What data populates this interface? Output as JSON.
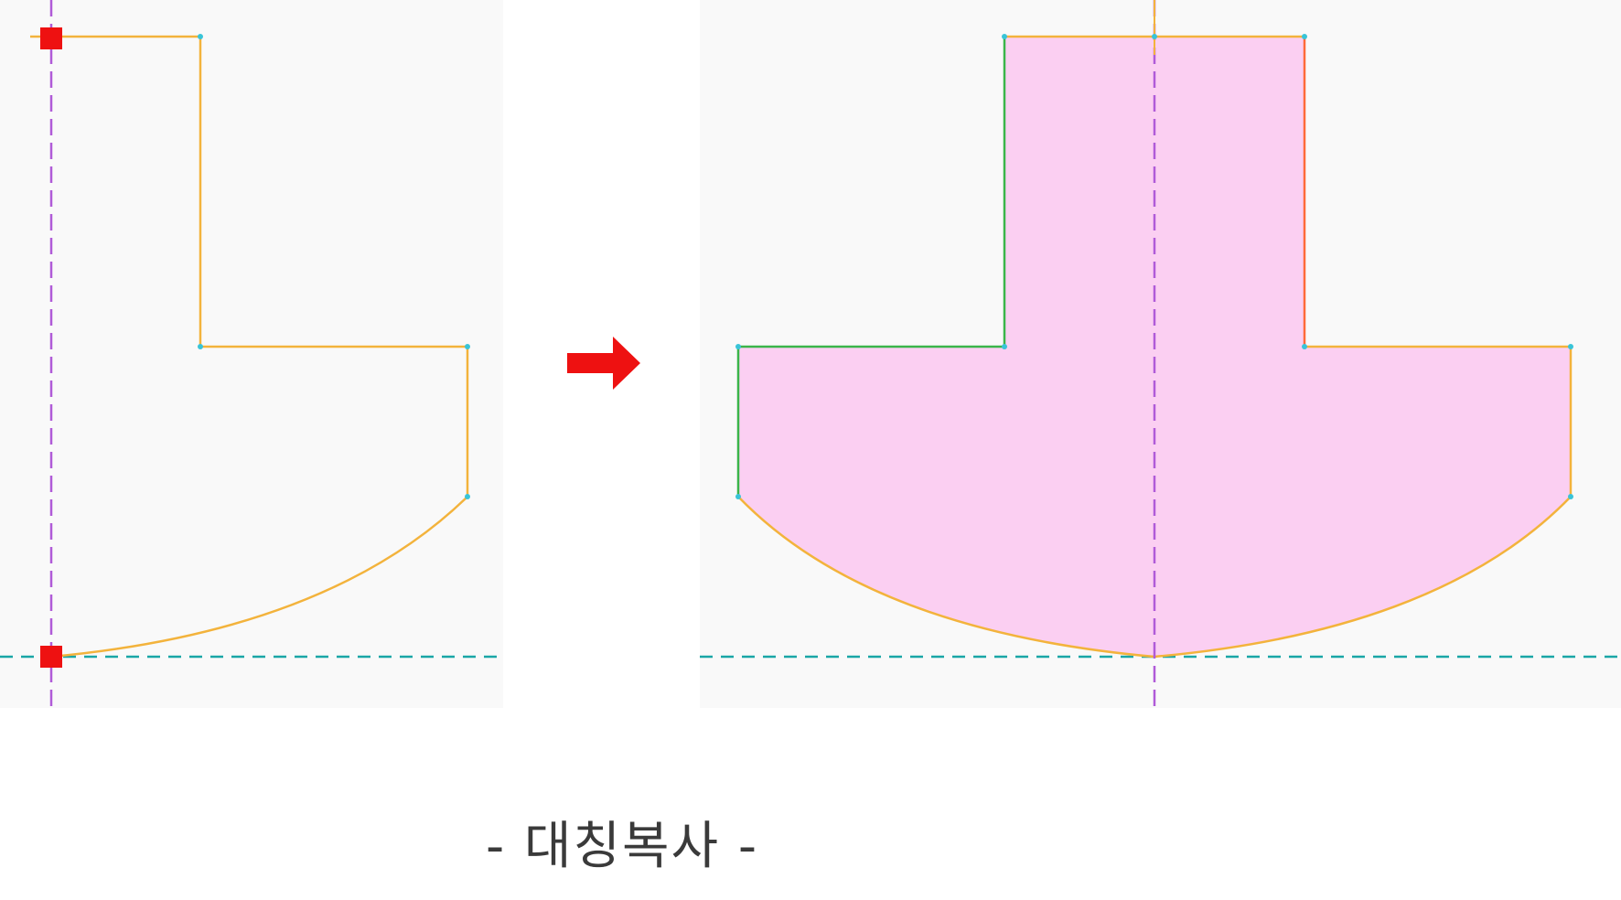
{
  "caption": "- 대칭복사 -",
  "colors": {
    "profile_edge": "#f3b33c",
    "mirrored_edge_green": "#3bb54a",
    "mirrored_edge_red": "#ff6a3a",
    "fill": "#fbcff2",
    "mirror_axis": "#b05bd8",
    "baseline": "#1aa6a6",
    "selection_marker": "#ee1111",
    "arrow": "#ee1111",
    "panel_background": "#f9f9f9"
  },
  "icons": {
    "arrow": "right-arrow-icon",
    "marker": "selection-marker-icon"
  }
}
